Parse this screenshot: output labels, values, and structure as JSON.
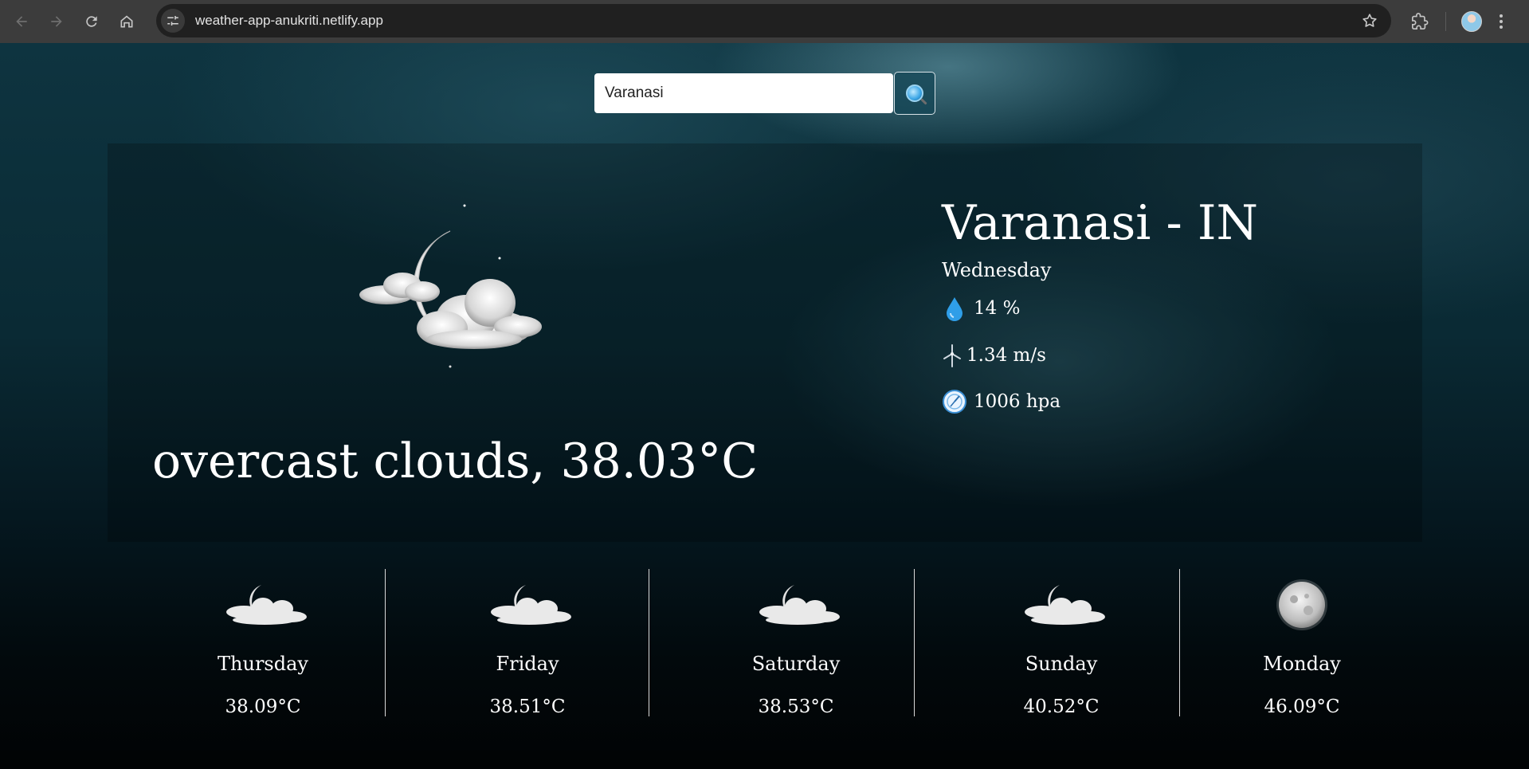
{
  "browser": {
    "url": "weather-app-anukriti.netlify.app"
  },
  "search": {
    "value": "Varanasi",
    "placeholder": ""
  },
  "current": {
    "city": "Varanasi - IN",
    "day": "Wednesday",
    "condition": "overcast clouds, 38.03°C",
    "humidity": "14 %",
    "wind": "1.34 m/s",
    "pressure": "1006 hpa",
    "icon": "moon-clouds-icon"
  },
  "forecast": [
    {
      "day": "Thursday",
      "temp": "38.09°C",
      "icon": "moon-clouds-icon"
    },
    {
      "day": "Friday",
      "temp": "38.51°C",
      "icon": "moon-clouds-icon"
    },
    {
      "day": "Saturday",
      "temp": "38.53°C",
      "icon": "moon-clouds-icon"
    },
    {
      "day": "Sunday",
      "temp": "40.52°C",
      "icon": "moon-clouds-icon"
    },
    {
      "day": "Monday",
      "temp": "46.09°C",
      "icon": "full-moon-icon"
    }
  ],
  "colors": {
    "chrome_bar": "#3c3c3c",
    "omnibox": "#202020",
    "page_bg_top": "#0e3440",
    "page_bg_bottom": "#010304",
    "text": "#ffffff",
    "humidity_drop": "#2f9ee8"
  }
}
